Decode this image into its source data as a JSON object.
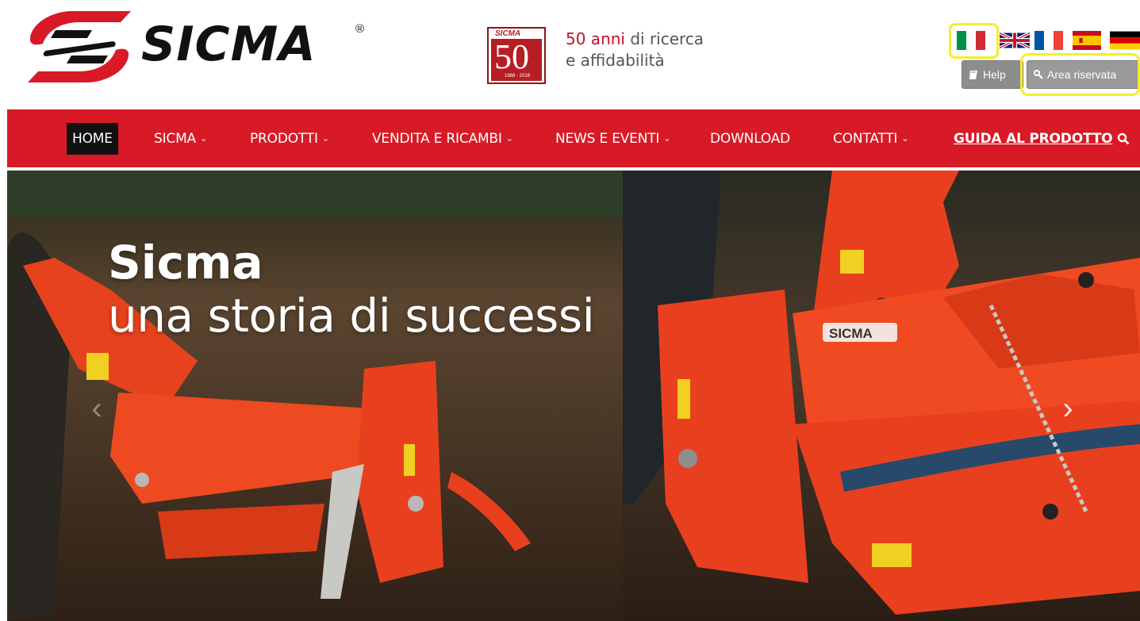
{
  "brand": {
    "name": "SICMA",
    "reg": "®"
  },
  "anniversary": {
    "badge_tag": "SICMA",
    "badge_number": "50",
    "badge_years": "1968 - 2018",
    "line1_highlight": "50 anni",
    "line1_rest": " di ricerca",
    "line2": "e affidabilità"
  },
  "languages": [
    "italiano",
    "english",
    "français",
    "español",
    "deutsch"
  ],
  "buttons": {
    "help": "Help",
    "area": "Area riservata"
  },
  "nav": {
    "home": "HOME",
    "sicma": "SICMA",
    "prodotti": "PRODOTTI",
    "vendita": "VENDITA E RICAMBI",
    "news": "NEWS E EVENTI",
    "download": "DOWNLOAD",
    "contatti": "CONTATTI",
    "guida": "GUIDA AL PRODOTTO"
  },
  "hero": {
    "title": "Sicma",
    "subtitle": "una storia di successi",
    "machine_logo": "SICMA"
  },
  "colors": {
    "brand_red": "#d71a26",
    "nav_active": "#111111",
    "highlight": "#f4ef2b",
    "machine_orange": "#e8401e"
  },
  "icons": [
    "book-icon",
    "key-icon",
    "chevron-down-icon",
    "search-icon",
    "chevron-left-icon",
    "chevron-right-icon"
  ]
}
